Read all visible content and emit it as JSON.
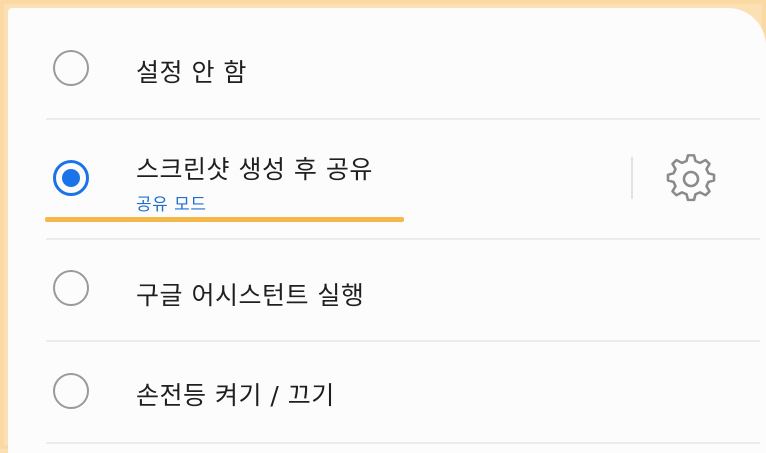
{
  "options": [
    {
      "label": "설정 안 함",
      "selected": false
    },
    {
      "label": "스크린샷 생성 후 공유",
      "sublabel": "공유 모드",
      "selected": true,
      "has_settings": true
    },
    {
      "label": "구글 어시스턴트 실행",
      "selected": false
    },
    {
      "label": "손전등 켜기 / 끄기",
      "selected": false
    }
  ],
  "icons": {
    "settings": "gear-icon"
  },
  "colors": {
    "accent": "#1a73e8",
    "sublabel": "#1f6fd1",
    "highlight": "#f6b84b",
    "frame": "#fbd9a2"
  }
}
